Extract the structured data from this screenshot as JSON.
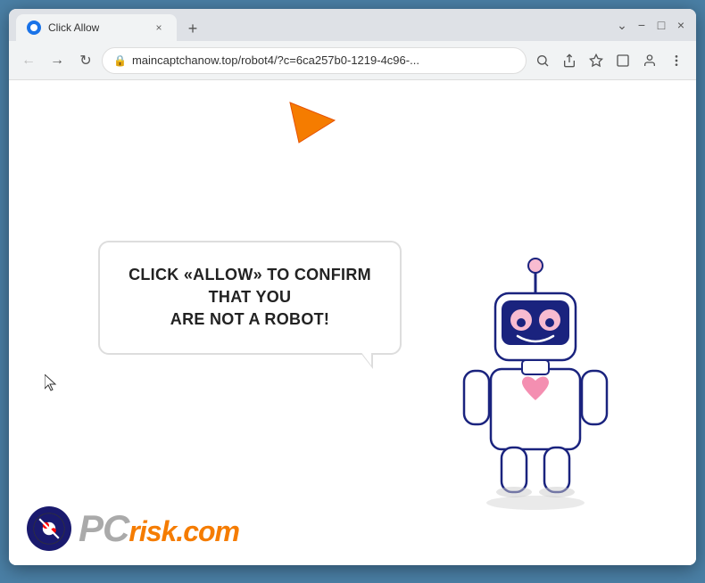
{
  "window": {
    "title": "Click Allow",
    "tab_close_label": "×",
    "new_tab_label": "+",
    "controls": {
      "minimize": "−",
      "maximize": "□",
      "close": "×"
    }
  },
  "toolbar": {
    "back_label": "←",
    "forward_label": "→",
    "reload_label": "↻",
    "address": "maincaptchanow.top/robot4/?c=6ca257b0-1219-4c96-...",
    "search_icon": "🔍",
    "share_icon": "⎙",
    "star_icon": "☆",
    "tab_icon": "⬜",
    "account_icon": "👤",
    "menu_icon": "⋮"
  },
  "page": {
    "bubble_line1": "CLICK «ALLOW» TO CONFIRM THAT YOU",
    "bubble_line2": "ARE NOT A ROBOT!"
  },
  "pcrisk": {
    "text_gray": "PC",
    "text_orange": "risk.com"
  }
}
